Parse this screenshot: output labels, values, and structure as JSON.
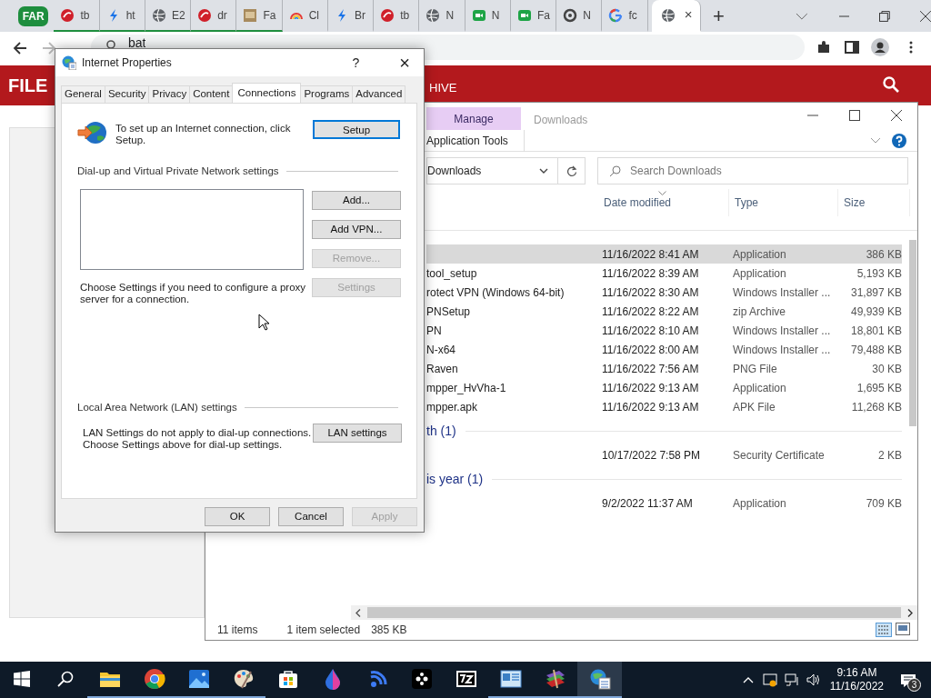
{
  "browser": {
    "group_label": "FAR",
    "tabs": [
      {
        "kind": "ask",
        "label": "tb",
        "grouped": true,
        "selected": false
      },
      {
        "kind": "bolt",
        "label": "ht",
        "grouped": true,
        "selected": false
      },
      {
        "kind": "globe",
        "label": "E2",
        "grouped": true,
        "selected": false
      },
      {
        "kind": "ask",
        "label": "dr",
        "grouped": true,
        "selected": false
      },
      {
        "kind": "image",
        "label": "Fa",
        "grouped": true,
        "selected": false
      },
      {
        "kind": "rainbow",
        "label": "Cl",
        "grouped": false,
        "selected": false
      },
      {
        "kind": "bolt",
        "label": "Br",
        "grouped": false,
        "selected": false
      },
      {
        "kind": "ask",
        "label": "tb",
        "grouped": false,
        "selected": false
      },
      {
        "kind": "globe",
        "label": "N",
        "grouped": false,
        "selected": false
      },
      {
        "kind": "camera",
        "label": "N",
        "grouped": false,
        "selected": false
      },
      {
        "kind": "camera",
        "label": "Fa",
        "grouped": false,
        "selected": false
      },
      {
        "kind": "ring",
        "label": "N",
        "grouped": false,
        "selected": false
      },
      {
        "kind": "google",
        "label": "fc",
        "grouped": false,
        "selected": false
      },
      {
        "kind": "globe",
        "close": "×",
        "grouped": false,
        "selected": true
      }
    ],
    "new_tab": "+",
    "address": "bat"
  },
  "page": {
    "logo": "FILE",
    "nav_text": "HIVE"
  },
  "explorer": {
    "ribbon_tab": "Manage",
    "title": "Downloads",
    "ribbon_label": "Application Tools",
    "location": "Downloads",
    "search_placeholder": "Search Downloads",
    "columns": [
      "Date modified",
      "Type",
      "Size"
    ],
    "items": [
      {
        "kind": "file",
        "date": "11/16/2022 8:41 AM",
        "type": "Application",
        "size": "386 KB",
        "selected": true
      },
      {
        "kind": "file",
        "name": "tool_setup",
        "date": "11/16/2022 8:39 AM",
        "type": "Application",
        "size": "5,193 KB",
        "selected": false
      },
      {
        "kind": "file",
        "name": "rotect VPN (Windows 64-bit)",
        "date": "11/16/2022 8:30 AM",
        "type": "Windows Installer ...",
        "size": "31,897 KB",
        "selected": false
      },
      {
        "kind": "file",
        "name": "PNSetup",
        "date": "11/16/2022 8:22 AM",
        "type": "zip Archive",
        "size": "49,939 KB",
        "selected": false
      },
      {
        "kind": "file",
        "name": "PN",
        "date": "11/16/2022 8:10 AM",
        "type": "Windows Installer ...",
        "size": "18,801 KB",
        "selected": false
      },
      {
        "kind": "file",
        "name": "N-x64",
        "date": "11/16/2022 8:00 AM",
        "type": "Windows Installer ...",
        "size": "79,488 KB",
        "selected": false
      },
      {
        "kind": "file",
        "name": "Raven",
        "date": "11/16/2022 7:56 AM",
        "type": "PNG File",
        "size": "30 KB",
        "selected": false
      },
      {
        "kind": "file",
        "name": "mpper_HvVha-1",
        "date": "11/16/2022 9:13 AM",
        "type": "Application",
        "size": "1,695 KB",
        "selected": false
      },
      {
        "kind": "file",
        "name": "mpper.apk",
        "date": "11/16/2022 9:13 AM",
        "type": "APK File",
        "size": "11,268 KB",
        "selected": false
      },
      {
        "kind": "group",
        "label": "th (1)"
      },
      {
        "kind": "file",
        "date": "10/17/2022 7:58 PM",
        "type": "Security Certificate",
        "size": "2 KB",
        "selected": false
      },
      {
        "kind": "group",
        "label": "is year (1)"
      },
      {
        "kind": "file",
        "date": "9/2/2022 11:37 AM",
        "type": "Application",
        "size": "709 KB",
        "selected": false
      }
    ],
    "status": {
      "count": "11 items",
      "selection": "1 item selected",
      "selection_size": "385 KB"
    }
  },
  "dialog": {
    "title": "Internet Properties",
    "help": "?",
    "close": "×",
    "tabs": [
      {
        "label": "General",
        "selected": false
      },
      {
        "label": "Security",
        "selected": false
      },
      {
        "label": "Privacy",
        "selected": false
      },
      {
        "label": "Content",
        "selected": false
      },
      {
        "label": "Connections",
        "selected": true
      },
      {
        "label": "Programs",
        "selected": false
      },
      {
        "label": "Advanced",
        "selected": false
      }
    ],
    "setup_text": "To set up an Internet connection, click Setup.",
    "setup_button": "Setup",
    "vpn_heading": "Dial-up and Virtual Private Network settings",
    "vpn_buttons": [
      {
        "label": "Add...",
        "disabled": false
      },
      {
        "label": "Add VPN...",
        "disabled": false
      },
      {
        "label": "Remove...",
        "disabled": true
      },
      {
        "label": "Settings",
        "disabled": true
      }
    ],
    "proxy_text": "Choose Settings if you need to configure a proxy server for a connection.",
    "lan_heading": "Local Area Network (LAN) settings",
    "lan_text": "LAN Settings do not apply to dial-up connections.\nChoose Settings above for dial-up settings.",
    "lan_button": "LAN settings",
    "footer_buttons": [
      {
        "label": "OK",
        "disabled": false
      },
      {
        "label": "Cancel",
        "disabled": false
      },
      {
        "label": "Apply",
        "disabled": true
      }
    ]
  },
  "taskbar": {
    "apps": [
      {
        "kind": "folder",
        "running": true,
        "active": false
      },
      {
        "kind": "browser",
        "running": true,
        "active": false
      },
      {
        "kind": "photos",
        "running": true,
        "active": false
      },
      {
        "kind": "palette",
        "running": true,
        "active": false
      },
      {
        "kind": "bag",
        "running": false,
        "active": false
      },
      {
        "kind": "droplet",
        "running": false,
        "active": false
      },
      {
        "kind": "signal",
        "running": false,
        "active": false
      },
      {
        "kind": "dots",
        "running": false,
        "active": false
      },
      {
        "kind": "archive",
        "running": false,
        "active": false
      },
      {
        "kind": "window",
        "running": true,
        "active": false
      },
      {
        "kind": "books",
        "running": true,
        "active": false
      },
      {
        "kind": "globe",
        "running": true,
        "active": true
      }
    ],
    "time": "9:16 AM",
    "date": "11/16/2022",
    "notifications": "3"
  }
}
